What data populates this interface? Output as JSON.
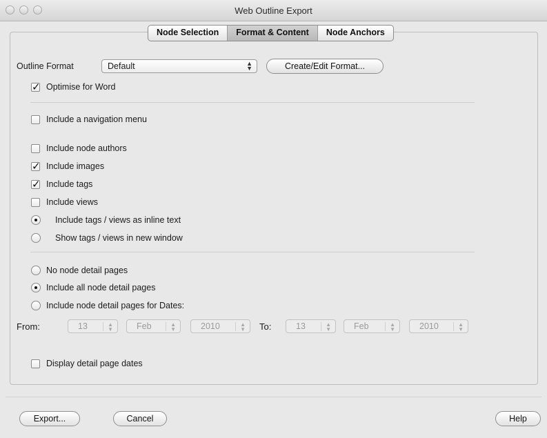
{
  "window": {
    "title": "Web Outline Export"
  },
  "tabs": [
    {
      "label": "Node Selection",
      "active": false
    },
    {
      "label": "Format & Content",
      "active": true
    },
    {
      "label": "Node Anchors",
      "active": false
    }
  ],
  "outline_format": {
    "label": "Outline Format",
    "value": "Default",
    "create_button": "Create/Edit Format..."
  },
  "checkboxes": {
    "optimise_word": {
      "label": "Optimise for Word",
      "checked": true
    },
    "nav_menu": {
      "label": "Include a navigation menu",
      "checked": false
    },
    "node_authors": {
      "label": "Include node authors",
      "checked": false
    },
    "images": {
      "label": "Include images",
      "checked": true
    },
    "tags": {
      "label": "Include tags",
      "checked": true
    },
    "views": {
      "label": "Include views",
      "checked": false
    },
    "display_dates": {
      "label": "Display detail page dates",
      "checked": false
    }
  },
  "tag_view_radios": [
    {
      "label": "Include tags / views as inline text",
      "selected": true
    },
    {
      "label": "Show tags / views in new window",
      "selected": false
    }
  ],
  "detail_page_radios": [
    {
      "label": "No node detail pages",
      "selected": false
    },
    {
      "label": "Include all node detail pages",
      "selected": true
    },
    {
      "label": "Include node detail pages for Dates:",
      "selected": false
    }
  ],
  "dates": {
    "from_label": "From:",
    "to_label": "To:",
    "from": {
      "day": "13",
      "month": "Feb",
      "year": "2010"
    },
    "to": {
      "day": "13",
      "month": "Feb",
      "year": "2010"
    }
  },
  "buttons": {
    "export": "Export...",
    "cancel": "Cancel",
    "help": "Help"
  },
  "colors": {
    "window_bg": "#e8e8e8",
    "active_tab": "#c4c4c4",
    "separator": "#cfcfcf"
  }
}
